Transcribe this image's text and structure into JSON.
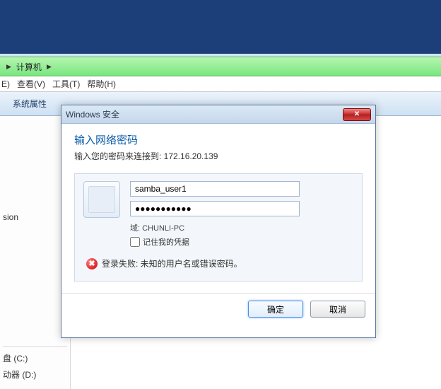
{
  "breadcrumb": {
    "root": "计算机",
    "arrow": "▶"
  },
  "menubar": {
    "edit": "E)",
    "view": "查看(V)",
    "tools": "工具(T)",
    "help": "帮助(H)"
  },
  "toolbar": {
    "item1": "系统属性"
  },
  "sidebar": {
    "item1": "sion",
    "drive_c": "盘 (C:)",
    "drive_d": "动器 (D:)"
  },
  "dialog": {
    "title": "Windows 安全",
    "heading": "输入网络密码",
    "sub_prefix": "输入您的密码来连接到: ",
    "sub_host": "172.16.20.139",
    "username": "samba_user1",
    "password_mask": "●●●●●●●●●●●",
    "domain_label": "域: ",
    "domain_value": "CHUNLI-PC",
    "remember": "记住我的凭据",
    "error": "登录失败: 未知的用户名或错误密码。",
    "ok": "确定",
    "cancel": "取消",
    "close_glyph": "✕"
  }
}
